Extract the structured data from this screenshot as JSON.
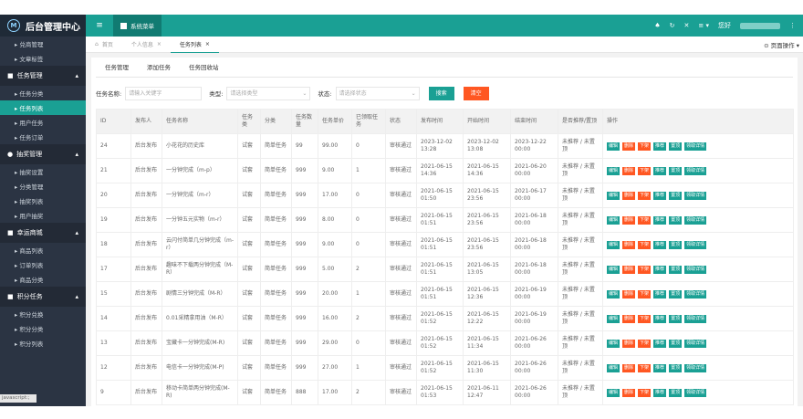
{
  "app": {
    "logo_glyph": "M",
    "title": "后台管理中心"
  },
  "topbar": {
    "menu_icon": "≡",
    "system_menu": "系统菜单",
    "right_icons": [
      "♠",
      "↻",
      "✕",
      "≡ ▾",
      "⋮"
    ],
    "user_prefix": "您好"
  },
  "sidebar": {
    "items_top": [
      {
        "label": "▸ 兑商管理"
      },
      {
        "label": "▸ 文章标签"
      }
    ],
    "groups": [
      {
        "title": "任务管理",
        "icon": "■",
        "items": [
          {
            "label": "▸ 任务分类",
            "active": false
          },
          {
            "label": "▸ 任务列表",
            "active": true
          },
          {
            "label": "▸ 用户任务",
            "active": false
          },
          {
            "label": "▸ 任务订单",
            "active": false
          }
        ]
      },
      {
        "title": "抽奖管理",
        "icon": "●",
        "items": [
          {
            "label": "▸ 抽奖设置",
            "active": false
          },
          {
            "label": "▸ 分类管理",
            "active": false
          },
          {
            "label": "▸ 抽奖列表",
            "active": false
          },
          {
            "label": "▸ 用户抽奖",
            "active": false
          }
        ]
      },
      {
        "title": "幸运商城",
        "icon": "■",
        "items": [
          {
            "label": "▸ 商品列表",
            "active": false
          },
          {
            "label": "▸ 订单列表",
            "active": false
          },
          {
            "label": "▸ 商品分类",
            "active": false
          }
        ]
      },
      {
        "title": "积分任务",
        "icon": "■",
        "items": [
          {
            "label": "▸ 积分兑换",
            "active": false
          },
          {
            "label": "▸ 积分分类",
            "active": false
          },
          {
            "label": "▸ 积分列表",
            "active": false
          }
        ]
      }
    ],
    "status_tip": "javascript:;"
  },
  "tabs": {
    "items": [
      {
        "label": "首页",
        "icon": "⌂",
        "active": false
      },
      {
        "label": "个人信息",
        "icon": "",
        "active": false,
        "close": "×"
      },
      {
        "label": "任务列表",
        "icon": "",
        "active": true,
        "close": "×"
      }
    ],
    "page_ops": "⊙ 页面操作 ▾"
  },
  "subtabs": [
    "任务管理",
    "添加任务",
    "任务回收站"
  ],
  "filters": {
    "name_label": "任务名称:",
    "name_placeholder": "请输入关键字",
    "type_label": "类型:",
    "type_placeholder": "请选择类型",
    "status_label": "状态:",
    "status_placeholder": "请选择状态",
    "search_btn": "搜索",
    "reset_btn": "清空"
  },
  "table": {
    "headers": [
      "ID",
      "发布人",
      "任务名称",
      "任务类",
      "分类",
      "任务数量",
      "任务单价",
      "已领取任务",
      "状态",
      "发布时间",
      "开始时间",
      "结束时间",
      "是否推荐/置顶",
      "操作"
    ],
    "ops": [
      "编辑",
      "删除",
      "下架",
      "推荐",
      "置顶",
      "领取详情"
    ],
    "rows": [
      {
        "id": "24",
        "publisher": "后台发布",
        "name": "小花花的历史库",
        "kind": "试套",
        "category": "简单任务",
        "qty": "99",
        "price": "99.00",
        "taken": "0",
        "status": "审核通过",
        "pub": "2023-12-02 13:28",
        "start": "2023-12-02 13:08",
        "end": "2023-12-22 00:00",
        "rec": "未推荐 / 未置顶"
      },
      {
        "id": "21",
        "publisher": "后台发布",
        "name": "一分钟完成（m-p）",
        "kind": "试套",
        "category": "简单任务",
        "qty": "999",
        "price": "9.00",
        "taken": "1",
        "status": "审核通过",
        "pub": "2021-06-15 14:36",
        "start": "2021-06-15 14:36",
        "end": "2021-06-20 00:00",
        "rec": "未推荐 / 未置顶"
      },
      {
        "id": "20",
        "publisher": "后台发布",
        "name": "一分钟完成（m-r）",
        "kind": "试套",
        "category": "简单任务",
        "qty": "999",
        "price": "17.00",
        "taken": "0",
        "status": "审核通过",
        "pub": "2021-06-15 01:50",
        "start": "2021-06-15 23:56",
        "end": "2021-06-17 00:00",
        "rec": "未推荐 / 未置顶"
      },
      {
        "id": "19",
        "publisher": "后台发布",
        "name": "一分钟五元实物（m-r）",
        "kind": "试套",
        "category": "简单任务",
        "qty": "999",
        "price": "8.00",
        "taken": "0",
        "status": "审核通过",
        "pub": "2021-06-15 01:51",
        "start": "2021-06-15 23:56",
        "end": "2021-06-18 00:00",
        "rec": "未推荐 / 未置顶"
      },
      {
        "id": "18",
        "publisher": "后台发布",
        "name": "云闪付简单几分钟完成（m-r）",
        "kind": "试套",
        "category": "简单任务",
        "qty": "999",
        "price": "9.00",
        "taken": "0",
        "status": "审核通过",
        "pub": "2021-06-15 01:51",
        "start": "2021-06-15 23:56",
        "end": "2021-06-18 00:00",
        "rec": "未推荐 / 未置顶"
      },
      {
        "id": "17",
        "publisher": "后台发布",
        "name": "趣味不下载两分钟完成（M-R）",
        "kind": "试套",
        "category": "简单任务",
        "qty": "999",
        "price": "5.00",
        "taken": "2",
        "status": "审核通过",
        "pub": "2021-06-15 01:51",
        "start": "2021-06-15 13:05",
        "end": "2021-06-18 00:00",
        "rec": "未推荐 / 未置顶"
      },
      {
        "id": "15",
        "publisher": "后台发布",
        "name": "剧情三分钟完成（M-R）",
        "kind": "试套",
        "category": "简单任务",
        "qty": "999",
        "price": "20.00",
        "taken": "1",
        "status": "审核通过",
        "pub": "2021-06-15 01:51",
        "start": "2021-06-15 12:36",
        "end": "2021-06-19 00:00",
        "rec": "未推荐 / 未置顶"
      },
      {
        "id": "14",
        "publisher": "后台发布",
        "name": "0.01采精拿用油（M-R）",
        "kind": "试套",
        "category": "简单任务",
        "qty": "999",
        "price": "16.00",
        "taken": "2",
        "status": "审核通过",
        "pub": "2021-06-15 01:52",
        "start": "2021-06-15 12:22",
        "end": "2021-06-19 00:00",
        "rec": "未推荐 / 未置顶"
      },
      {
        "id": "13",
        "publisher": "后台发布",
        "name": "宝藏卡一分钟完成(M-R)",
        "kind": "试套",
        "category": "简单任务",
        "qty": "999",
        "price": "29.00",
        "taken": "0",
        "status": "审核通过",
        "pub": "2021-06-15 01:52",
        "start": "2021-06-15 11:34",
        "end": "2021-06-26 00:00",
        "rec": "未推荐 / 未置顶"
      },
      {
        "id": "12",
        "publisher": "后台发布",
        "name": "电信卡一分钟完成(M-P)",
        "kind": "试套",
        "category": "简单任务",
        "qty": "999",
        "price": "27.00",
        "taken": "1",
        "status": "审核通过",
        "pub": "2021-06-15 01:52",
        "start": "2021-06-15 11:30",
        "end": "2021-06-26 00:00",
        "rec": "未推荐 / 未置顶"
      },
      {
        "id": "9",
        "publisher": "后台发布",
        "name": "移动卡简单两分钟完成(M-R)",
        "kind": "试套",
        "category": "简单任务",
        "qty": "888",
        "price": "17.00",
        "taken": "2",
        "status": "审核通过",
        "pub": "2021-06-15 01:53",
        "start": "2021-06-11 12:47",
        "end": "2021-06-26 00:00",
        "rec": "未推荐 / 未置顶"
      }
    ]
  }
}
